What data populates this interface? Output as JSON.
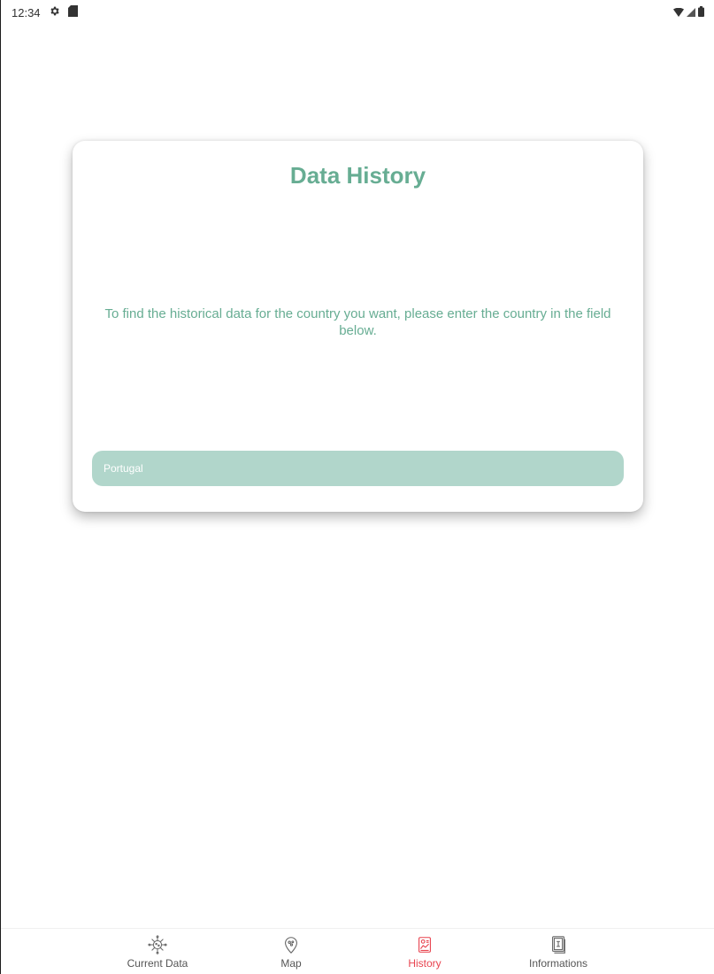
{
  "status_bar": {
    "time": "12:34",
    "left_icons": [
      "gear-icon",
      "sd-card-icon"
    ],
    "right_icons": [
      "wifi-icon",
      "signal-icon",
      "battery-icon"
    ]
  },
  "card": {
    "title": "Data History",
    "description": "To find the historical data for the country you want, please enter the country in the field below.",
    "country_field": {
      "value": "Portugal",
      "placeholder": ""
    }
  },
  "bottom_nav": {
    "items": [
      {
        "label": "Current Data",
        "icon": "virus-icon",
        "active": false
      },
      {
        "label": "Map",
        "icon": "map-pin-icon",
        "active": false
      },
      {
        "label": "History",
        "icon": "history-chart-icon",
        "active": true
      },
      {
        "label": "Informations",
        "icon": "info-document-icon",
        "active": false
      }
    ]
  },
  "colors": {
    "accent": "#67ad93",
    "field_bg": "#b1d6cb",
    "active_tab": "#e8434f",
    "inactive_tab": "#555555"
  }
}
